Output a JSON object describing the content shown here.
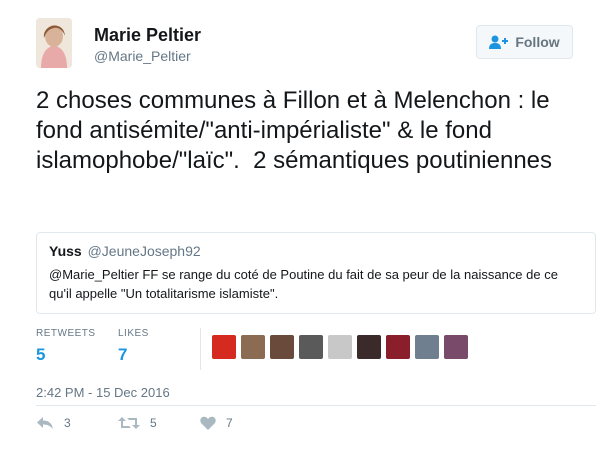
{
  "author": {
    "name": "Marie Peltier",
    "handle": "@Marie_Peltier"
  },
  "follow_button": {
    "label": "Follow",
    "icon": "add-user-icon"
  },
  "tweet": {
    "text": "2 choses communes à Fillon et à Melenchon : le fond antisémite/\"anti-impérialiste\" & le fond islamophobe/\"laïc\".  2 sémantiques poutiniennes"
  },
  "quoted_tweet": {
    "name": "Yuss",
    "handle": "@JeuneJoseph92",
    "text": "@Marie_Peltier  FF se range du coté de Poutine du fait de sa peur de la naissance de ce qu'il appelle \"Un totalitarisme islamiste\"."
  },
  "stats": {
    "retweets_label": "RETWEETS",
    "retweets_count": "5",
    "likes_label": "LIKES",
    "likes_count": "7"
  },
  "likers": [
    {
      "color": "#d42a1f"
    },
    {
      "color": "#8b6b52"
    },
    {
      "color": "#6a4a3a"
    },
    {
      "color": "#5a5a5a"
    },
    {
      "color": "#c8c8c8"
    },
    {
      "color": "#3a2a2a"
    },
    {
      "color": "#8a1e2a"
    },
    {
      "color": "#6f7f8f"
    },
    {
      "color": "#7a4a6a"
    }
  ],
  "timestamp": "2:42 PM - 15 Dec 2016",
  "actions": {
    "reply_count": "3",
    "retweet_count": "5",
    "like_count": "7"
  },
  "colors": {
    "link_blue": "#1b95e0",
    "muted_gray": "#657786",
    "border": "#e1e8ed"
  }
}
